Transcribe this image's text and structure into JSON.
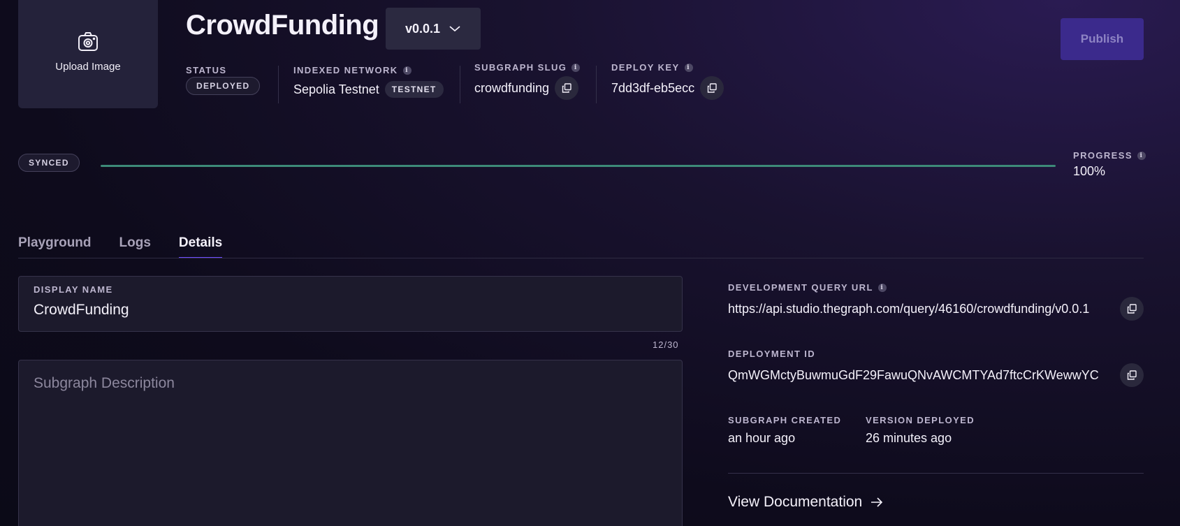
{
  "upload": {
    "label": "Upload Image",
    "icon": "camera-icon"
  },
  "header": {
    "title": "CrowdFunding",
    "version": "v0.0.1",
    "publish_label": "Publish"
  },
  "meta": {
    "status_label": "STATUS",
    "status_value": "DEPLOYED",
    "network_label": "INDEXED NETWORK",
    "network_value": "Sepolia Testnet",
    "network_badge": "TESTNET",
    "slug_label": "SUBGRAPH SLUG",
    "slug_value": "crowdfunding",
    "deploy_key_label": "DEPLOY KEY",
    "deploy_key_value": "7dd3df-eb5ecc",
    "info_glyph": "i"
  },
  "sync": {
    "status": "SYNCED",
    "progress_label": "PROGRESS",
    "progress_value": "100%",
    "progress_fraction": 1.0,
    "bar_color": "#3d8a78"
  },
  "tabs": [
    {
      "label": "Playground",
      "active": false
    },
    {
      "label": "Logs",
      "active": false
    },
    {
      "label": "Details",
      "active": true
    }
  ],
  "form": {
    "display_name_label": "DISPLAY NAME",
    "display_name_value": "CrowdFunding",
    "char_count": "12/30",
    "description_placeholder": "Subgraph Description"
  },
  "details": {
    "query_url_label": "DEVELOPMENT QUERY URL",
    "query_url_value": "https://api.studio.thegraph.com/query/46160/crowdfunding/v0.0.1",
    "deployment_id_label": "DEPLOYMENT ID",
    "deployment_id_value": "QmWGMctyBuwmuGdF29FawuQNvAWCMTYAd7ftcCrKWewwYC",
    "created_label": "SUBGRAPH CREATED",
    "created_value": "an hour ago",
    "deployed_label": "VERSION DEPLOYED",
    "deployed_value": "26 minutes ago",
    "view_docs": "View Documentation"
  },
  "colors": {
    "accent": "#6f4cff",
    "publish_bg": "#3b2a8c",
    "panel_bg": "#1c1a2c"
  }
}
